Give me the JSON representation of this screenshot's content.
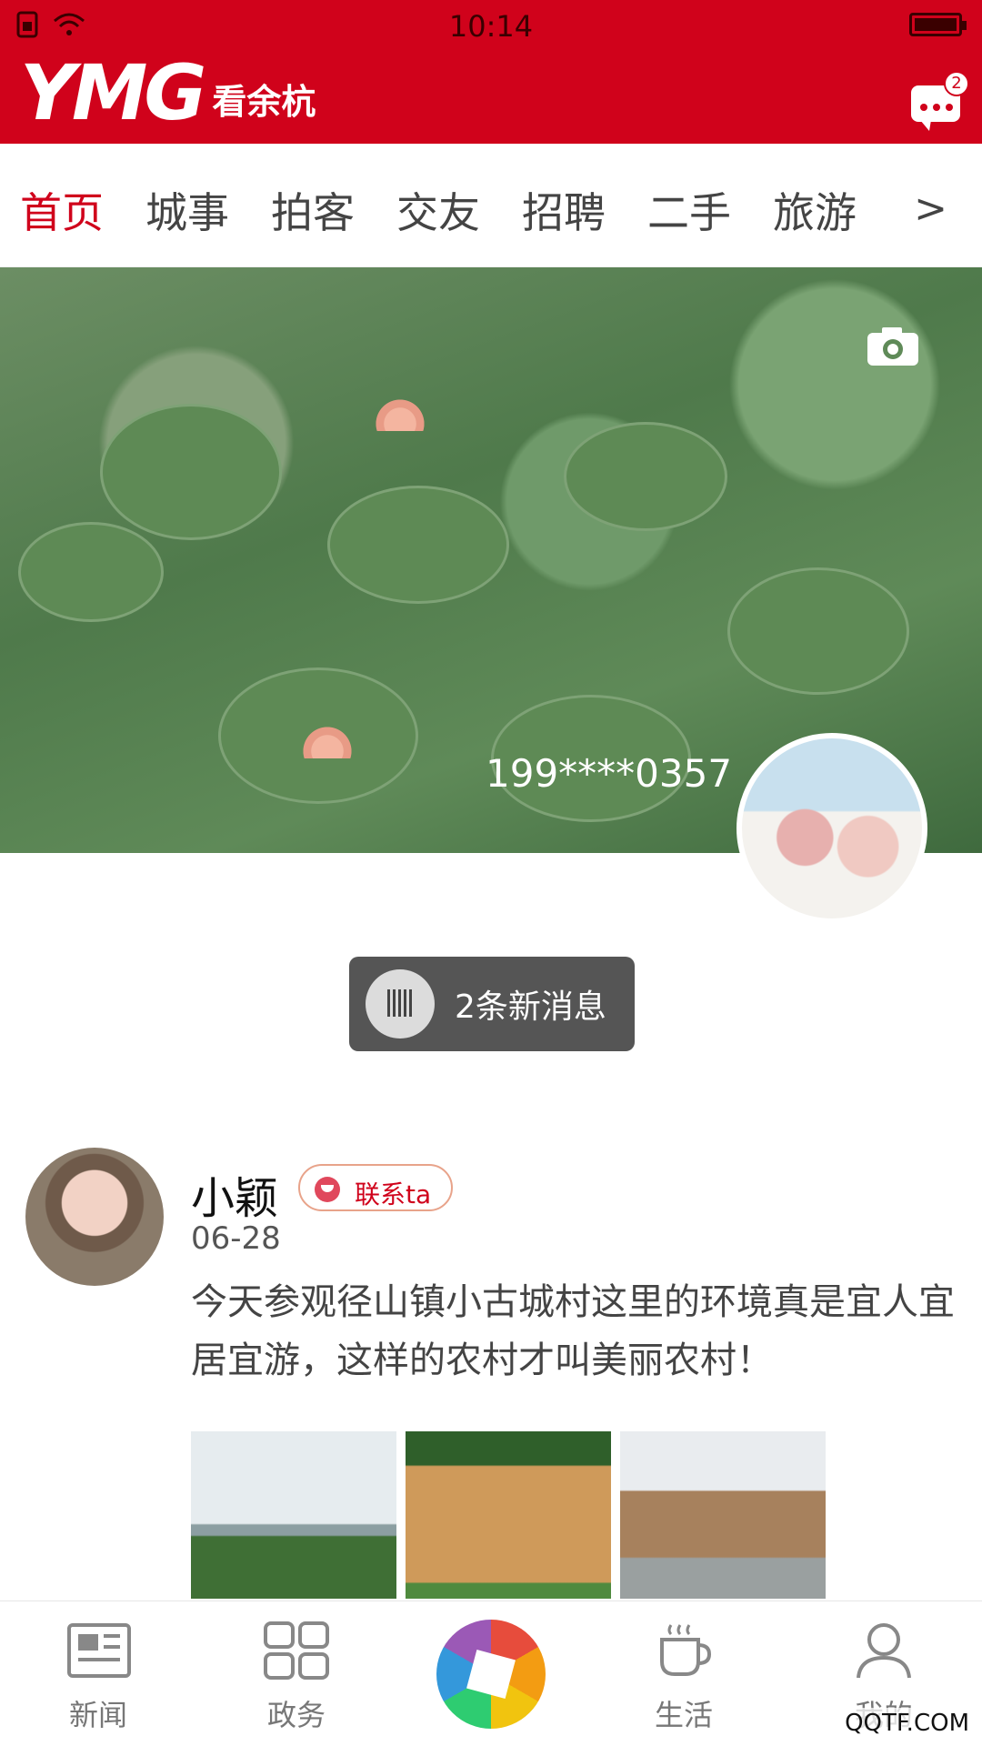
{
  "status_bar": {
    "time": "10:14"
  },
  "header": {
    "logo_text": "YMG",
    "logo_sub": "看余杭",
    "message_badge": "2"
  },
  "tabs": [
    "首页",
    "城事",
    "拍客",
    "交友",
    "招聘",
    "二手",
    "旅游"
  ],
  "tabs_more": ">",
  "cover": {
    "phone": "199****0357"
  },
  "new_messages": "2条新消息",
  "post": {
    "author": "小颖",
    "contact_label": "联系ta",
    "date": "06-28",
    "text": "今天参观径山镇小古城村这里的环境真是宜人宜居宜游，这样的农村才叫美丽农村！"
  },
  "bottom_nav": {
    "news": "新闻",
    "gov": "政务",
    "life": "生活",
    "mine": "我的"
  },
  "watermark": "QQTF.COM"
}
